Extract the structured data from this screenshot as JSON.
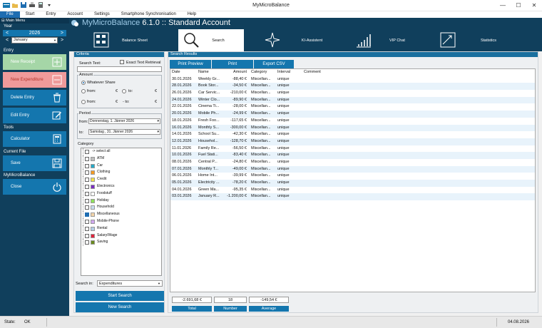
{
  "window": {
    "title": "MyMicroBalance"
  },
  "menu": [
    "File",
    "Start",
    "Entry",
    "Account",
    "Settings",
    "Smartphone Synchronisation",
    "Help"
  ],
  "header": {
    "brand": "MyMicroBalance",
    "version": "6.1.0",
    "account": ":: Standard Account"
  },
  "tabs": [
    {
      "label": "Balance Sheet",
      "icon": "balance-icon"
    },
    {
      "label": "Search",
      "icon": "search-icon",
      "active": true
    },
    {
      "label": "KI-Assistent",
      "icon": "sparkle-icon"
    },
    {
      "label": "VIP Chat",
      "icon": "growth-icon"
    },
    {
      "label": "Statistics",
      "icon": "statistics-icon"
    }
  ],
  "sidebar": {
    "header": "Main Menu",
    "year_label": "Year",
    "year": "2026",
    "month": "January",
    "entry_label": "Entry",
    "new_receipt": "New Receipt",
    "new_expenditure": "New Expenditure",
    "delete_entry": "Delete Entry",
    "edit_entry": "Edit Entry",
    "tools_label": "Tools",
    "calculator": "Calculator",
    "current_file_label": "Current File",
    "save": "Save",
    "app_label": "MyMicroBalance",
    "close": "Close"
  },
  "criteria": {
    "title": "Criteria",
    "search_text_label": "Search Text:",
    "exact_label": "Exact Text Retrieval",
    "amount_label": "Amount",
    "whatever_share": "Whatever Share",
    "from": "from:",
    "to": "to:",
    "currency": "€",
    "period_label": "Period",
    "period_from": "Donnerstag,  1.  Jänner  2026",
    "period_to": "Samstag ,  31.  Jänner  2026",
    "category_label": "Category",
    "select_all": "-> select all",
    "categories": [
      {
        "name": "ATM",
        "color": "#bfbfbf",
        "checked": false
      },
      {
        "name": "Car",
        "color": "#26a9c8",
        "checked": false
      },
      {
        "name": "Clothing",
        "color": "#f59a23",
        "checked": false
      },
      {
        "name": "Credit",
        "color": "#f2e04a",
        "checked": false
      },
      {
        "name": "Electronics",
        "color": "#7a2ec2",
        "checked": false
      },
      {
        "name": "Foodstuff",
        "color": "#ffffff",
        "checked": false
      },
      {
        "name": "Holiday",
        "color": "#8fe05a",
        "checked": false
      },
      {
        "name": "Household",
        "color": "#c7dcf0",
        "checked": false
      },
      {
        "name": "Miscellaneous",
        "color": "#f2d3a8",
        "checked": true
      },
      {
        "name": "Mobile-Phone",
        "color": "#d0a7ee",
        "checked": false
      },
      {
        "name": "Rental",
        "color": "#b4cde6",
        "checked": false
      },
      {
        "name": "Salary/Wage",
        "color": "#e0243c",
        "checked": false
      },
      {
        "name": "Saving",
        "color": "#6a8a1f",
        "checked": false
      }
    ],
    "search_in_label": "Search in:",
    "search_in": "Expenditures",
    "start_search": "Start Search",
    "new_search": "New Search"
  },
  "results": {
    "title": "Search Results",
    "print_preview": "Print Preview",
    "print": "Print",
    "export_csv": "Export CSV",
    "columns": [
      "Date",
      "Name",
      "Amount",
      "Category",
      "Interval",
      "Comment"
    ],
    "rows": [
      [
        "30.01.2026",
        "Weekly Gr...",
        "-88,40 €",
        "Miscellan...",
        "unique",
        ""
      ],
      [
        "28.01.2026",
        "Book Stor...",
        "-34,50 €",
        "Miscellan...",
        "unique",
        ""
      ],
      [
        "26.01.2026",
        "Car Servic...",
        "-210,00 €",
        "Miscellan...",
        "unique",
        ""
      ],
      [
        "24.01.2026",
        "Winter Clo...",
        "-89,90 €",
        "Miscellan...",
        "unique",
        ""
      ],
      [
        "22.01.2026",
        "Cinema Ti...",
        "-28,00 €",
        "Miscellan...",
        "unique",
        ""
      ],
      [
        "20.01.2026",
        "Mobile Ph...",
        "-24,99 €",
        "Miscellan...",
        "unique",
        ""
      ],
      [
        "18.01.2026",
        "Fresh Foo...",
        "-117,65 €",
        "Miscellan...",
        "unique",
        ""
      ],
      [
        "16.01.2026",
        "Monthly S...",
        "-300,00 €",
        "Miscellan...",
        "unique",
        ""
      ],
      [
        "14.01.2026",
        "School Su...",
        "-42,30 €",
        "Miscellan...",
        "unique",
        ""
      ],
      [
        "12.01.2026",
        "Househol...",
        "-128,70 €",
        "Miscellan...",
        "unique",
        ""
      ],
      [
        "11.01.2026",
        "Family Re...",
        "-56,50 €",
        "Miscellan...",
        "unique",
        ""
      ],
      [
        "10.01.2026",
        "Fuel Stati...",
        "-83,40 €",
        "Miscellan...",
        "unique",
        ""
      ],
      [
        "08.01.2026",
        "Central P...",
        "-24,80 €",
        "Miscellan...",
        "unique",
        ""
      ],
      [
        "07.01.2026",
        "Monthly T...",
        "-49,00 €",
        "Miscellan...",
        "unique",
        ""
      ],
      [
        "06.01.2026",
        "Home Int...",
        "-39,99 €",
        "Miscellan...",
        "unique",
        ""
      ],
      [
        "05.01.2026",
        "Electricity ...",
        "-78,20 €",
        "Miscellan...",
        "unique",
        ""
      ],
      [
        "04.01.2026",
        "Green Ma...",
        "-95,35 €",
        "Miscellan...",
        "unique",
        ""
      ],
      [
        "03.01.2026",
        "January R...",
        "-1.200,00 €",
        "Miscellan...",
        "unique",
        ""
      ]
    ],
    "total": "-2.691,68 €",
    "total_label": "Total",
    "number": "18",
    "number_label": "Number",
    "average": "-149,54 €",
    "average_label": "Average"
  },
  "status": {
    "state_label": "State:",
    "state": "OK",
    "date": "04.08.2026"
  },
  "colors": {
    "primary": "#1476ae",
    "dark": "#103f5c",
    "row_alt": "#e8f3fb"
  }
}
